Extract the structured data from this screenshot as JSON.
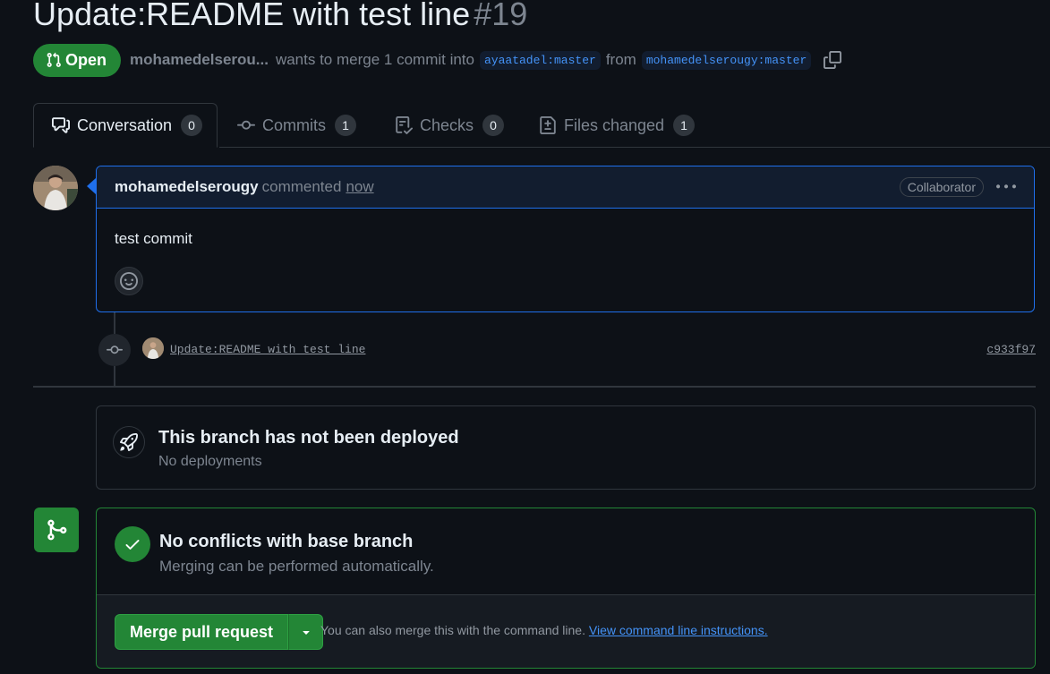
{
  "pr": {
    "title": "Update:README with test line",
    "number": "#19",
    "state": "Open",
    "author_short": "mohamedelserou...",
    "merge_text": "wants to merge 1 commit into",
    "base_branch": "ayaatadel:master",
    "from_text": "from",
    "head_branch": "mohamedelserougy:master"
  },
  "tabs": [
    {
      "label": "Conversation",
      "count": "0"
    },
    {
      "label": "Commits",
      "count": "1"
    },
    {
      "label": "Checks",
      "count": "0"
    },
    {
      "label": "Files changed",
      "count": "1"
    }
  ],
  "comment": {
    "author": "mohamedelserougy",
    "verb": "commented",
    "time": "now",
    "role": "Collaborator",
    "body": "test commit"
  },
  "commit": {
    "message": "Update:README with test line",
    "sha": "c933f97"
  },
  "deploy": {
    "title": "This branch has not been deployed",
    "subtitle": "No deployments"
  },
  "merge": {
    "title": "No conflicts with base branch",
    "subtitle": "Merging can be performed automatically.",
    "button": "Merge pull request",
    "hint": "You can also merge this with the command line.",
    "hint_link": "View command line instructions."
  },
  "colors": {
    "background": "#0d1117",
    "accent_green": "#238636",
    "accent_blue": "#1f6feb",
    "link": "#4493f8"
  }
}
